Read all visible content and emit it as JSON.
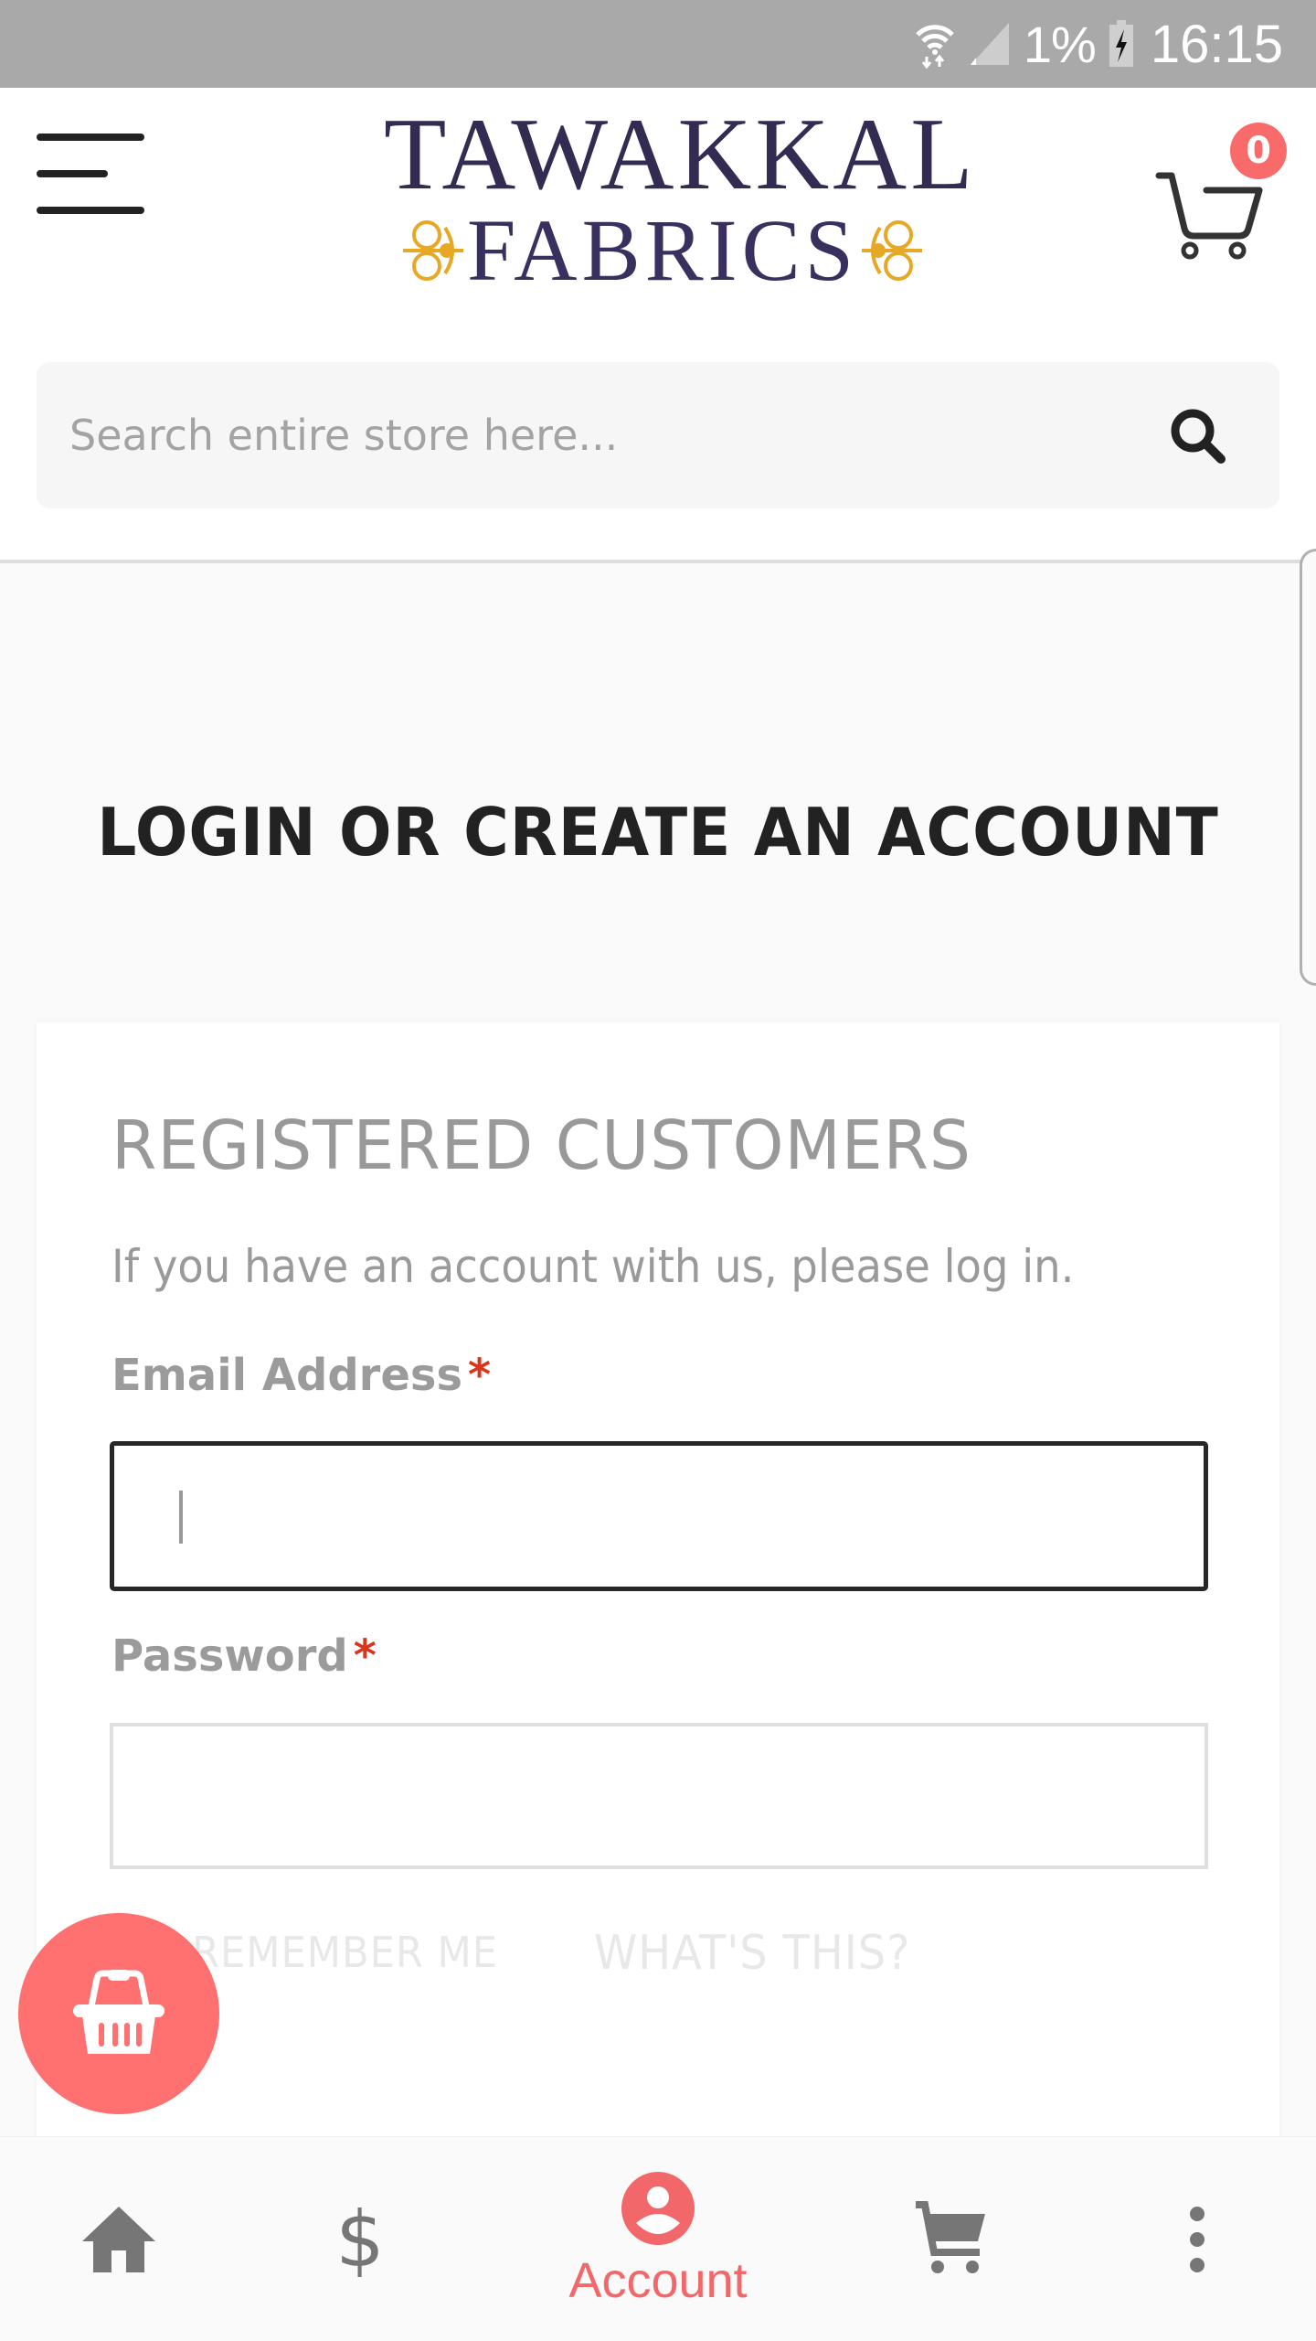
{
  "status_bar": {
    "battery_percent": "1%",
    "time": "16:15",
    "icons": [
      "wifi-data-icon",
      "signal-icon",
      "battery-charging-icon"
    ]
  },
  "header": {
    "brand_line1": "TAWAKKAL",
    "brand_line2": "FABRICS",
    "cart_count": "0",
    "menu_icon": "hamburger-icon",
    "cart_icon": "cart-outline-icon"
  },
  "search": {
    "placeholder": "Search entire store here...",
    "value": "",
    "icon": "search-icon"
  },
  "page": {
    "title": "LOGIN OR CREATE AN ACCOUNT"
  },
  "login": {
    "section_title": "REGISTERED CUSTOMERS",
    "intro": "If you have an account with us, please log in.",
    "email_label": "Email Address",
    "email_value": "",
    "password_label": "Password",
    "password_value": "",
    "required_mark": "*",
    "remember_me": "REMEMBER ME",
    "whats_this": "WHAT'S THIS?"
  },
  "fab": {
    "icon": "basket-icon"
  },
  "bottom_nav": {
    "items": [
      {
        "icon": "home-icon",
        "label": ""
      },
      {
        "icon": "dollar-icon",
        "label": "",
        "glyph": "$"
      },
      {
        "icon": "account-icon",
        "label": "Account",
        "active": true
      },
      {
        "icon": "cart-icon",
        "label": ""
      },
      {
        "icon": "more-vertical-icon",
        "label": ""
      }
    ]
  },
  "colors": {
    "accent": "#f96b6b",
    "fab": "#fe7170",
    "required": "#d9341c",
    "status_bar": "#a9a9a9",
    "logo_text": "#342b52",
    "logo_ornament": "#e6a825"
  }
}
